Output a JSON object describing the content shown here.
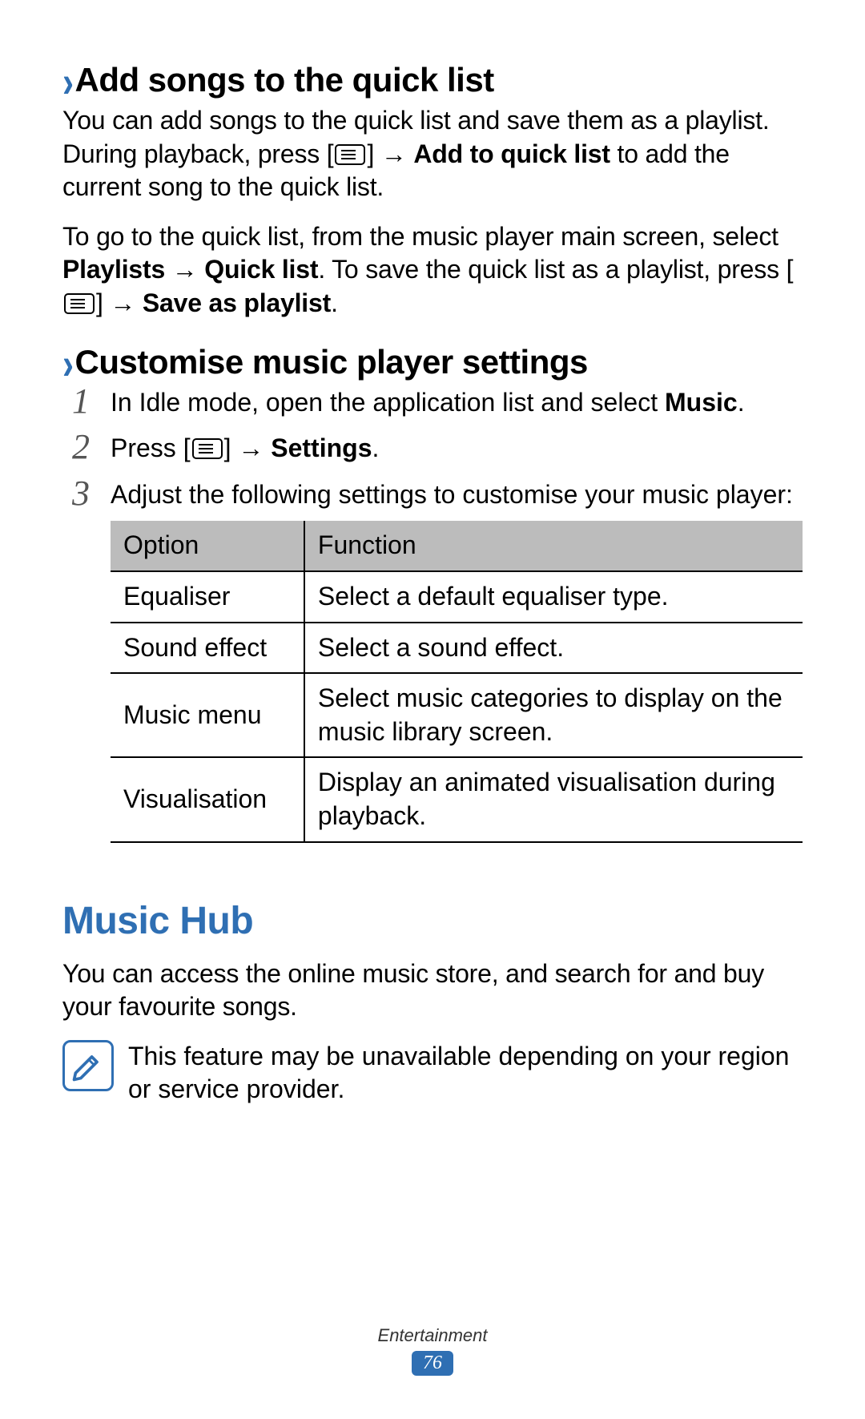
{
  "sections": {
    "quicklist": {
      "heading": "Add songs to the quick list",
      "p1_a": "You can add songs to the quick list and save them as a playlist. During playback, press [",
      "p1_b": "] → ",
      "p1_bold1": "Add to quick list",
      "p1_c": " to add the current song to the quick list.",
      "p2_a": "To go to the quick list, from the music player main screen, select ",
      "p2_bold1": "Playlists",
      "p2_b": " → ",
      "p2_bold2": "Quick list",
      "p2_c": ". To save the quick list as a playlist, press [",
      "p2_d": "] → ",
      "p2_bold3": "Save as playlist",
      "p2_e": "."
    },
    "customise": {
      "heading": "Customise music player settings",
      "steps": [
        {
          "n": "1",
          "a": "In Idle mode, open the application list and select ",
          "bold": "Music",
          "b": "."
        },
        {
          "n": "2",
          "a": "Press [",
          "mid": "] → ",
          "bold": "Settings",
          "b": "."
        },
        {
          "n": "3",
          "a": "Adjust the following settings to customise your music player:"
        }
      ],
      "table": {
        "head": {
          "option": "Option",
          "function": "Function"
        },
        "rows": [
          {
            "option": "Equaliser",
            "function": "Select a default equaliser type."
          },
          {
            "option": "Sound effect",
            "function": "Select a sound effect."
          },
          {
            "option": "Music menu",
            "function": "Select music categories to display on the music library screen."
          },
          {
            "option": "Visualisation",
            "function": "Display an animated visualisation during playback."
          }
        ]
      }
    },
    "musichub": {
      "heading": "Music Hub",
      "p1": "You can access the online music store, and search for and buy your favourite songs.",
      "note": "This feature may be unavailable depending on your region or service provider."
    }
  },
  "footer": {
    "category": "Entertainment",
    "page": "76"
  },
  "icons": {
    "menu": "menu-key-icon",
    "note": "note-pencil-icon"
  },
  "colors": {
    "accent": "#2f6fb3"
  }
}
